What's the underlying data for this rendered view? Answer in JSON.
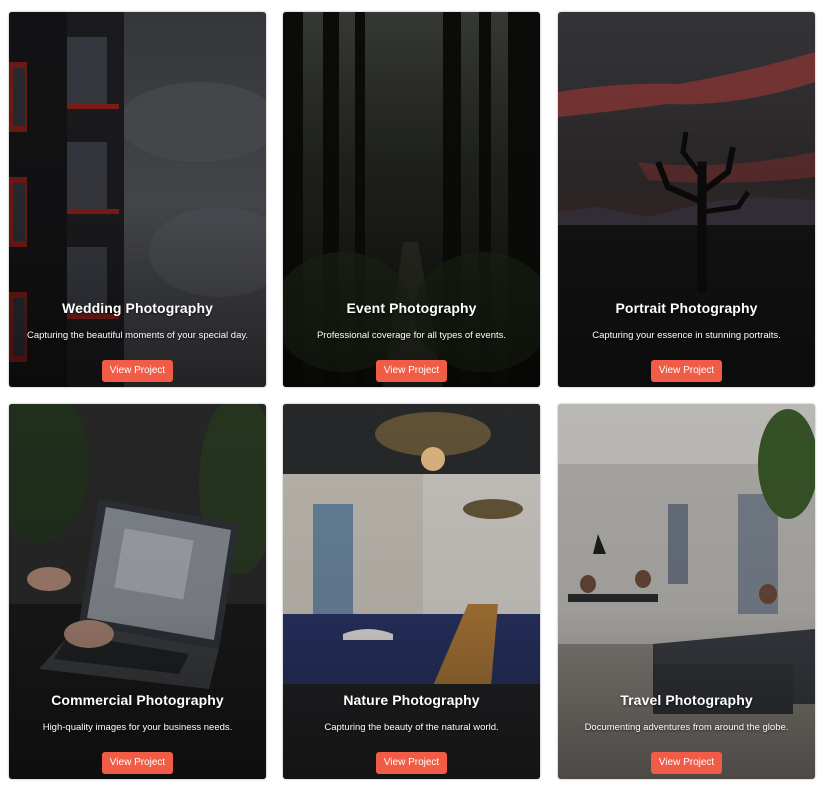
{
  "cards": [
    {
      "title": "Wedding Photography",
      "description": "Capturing the beautiful moments of your special day.",
      "button": "View Project"
    },
    {
      "title": "Event Photography",
      "description": "Professional coverage for all types of events.",
      "button": "View Project"
    },
    {
      "title": "Portrait Photography",
      "description": "Capturing your essence in stunning portraits.",
      "button": "View Project"
    },
    {
      "title": "Commercial Photography",
      "description": "High-quality images for your business needs.",
      "button": "View Project"
    },
    {
      "title": "Nature Photography",
      "description": "Capturing the beauty of the natural world.",
      "button": "View Project"
    },
    {
      "title": "Travel Photography",
      "description": "Documenting adventures from around the globe.",
      "button": "View Project"
    }
  ],
  "colors": {
    "button": "#f05c45",
    "page_background": "#ffffff"
  }
}
